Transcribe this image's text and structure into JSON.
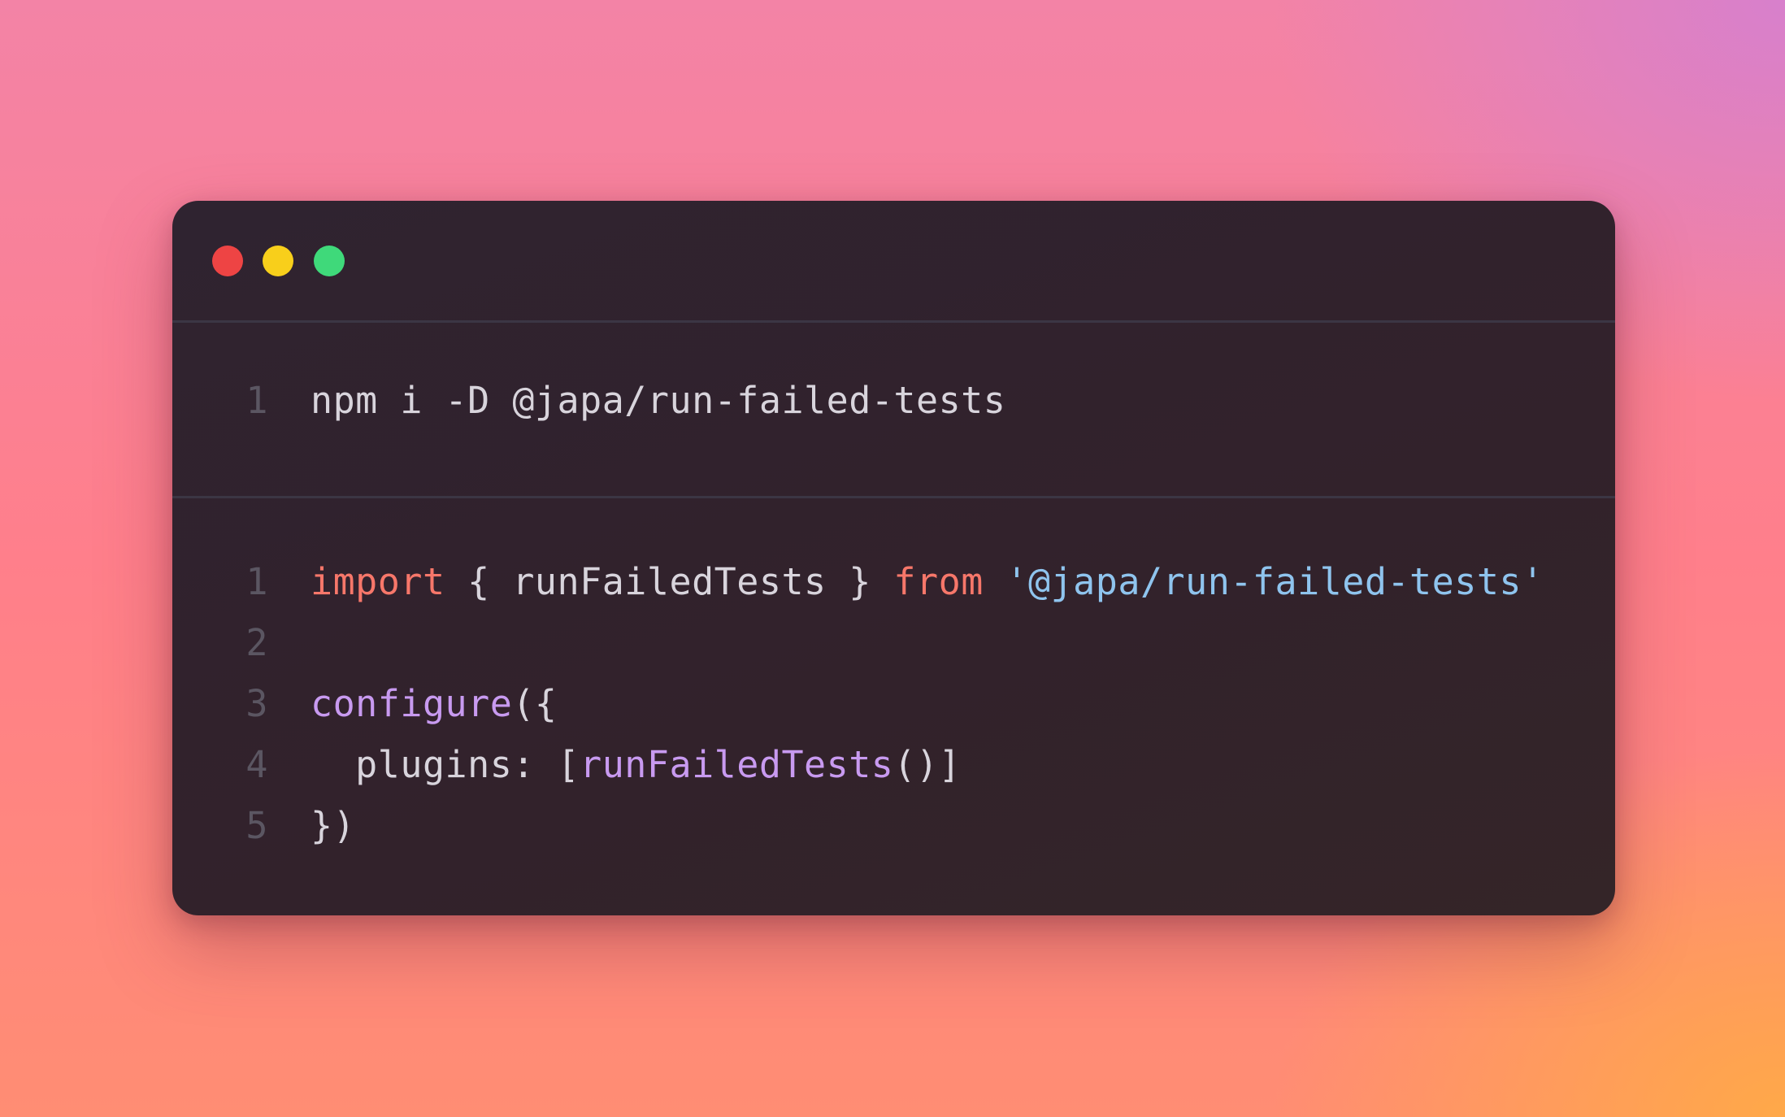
{
  "window_controls": {
    "close_color": "#ee4444",
    "minimize_color": "#f8cf1b",
    "maximize_color": "#3fd97a"
  },
  "terminal_block": {
    "lines": [
      {
        "number": "1",
        "tokens": [
          {
            "text": "npm i -D @japa/run-failed-tests",
            "type": "plain"
          }
        ]
      }
    ]
  },
  "code_block": {
    "lines": [
      {
        "number": "1",
        "tokens": [
          {
            "text": "import",
            "type": "keyword"
          },
          {
            "text": " { runFailedTests } ",
            "type": "plain"
          },
          {
            "text": "from",
            "type": "keyword"
          },
          {
            "text": " ",
            "type": "plain"
          },
          {
            "text": "'@japa/run-failed-tests'",
            "type": "string"
          }
        ]
      },
      {
        "number": "2",
        "tokens": []
      },
      {
        "number": "3",
        "tokens": [
          {
            "text": "configure",
            "type": "func"
          },
          {
            "text": "({",
            "type": "plain"
          }
        ]
      },
      {
        "number": "4",
        "tokens": [
          {
            "text": "  plugins: [",
            "type": "plain"
          },
          {
            "text": "runFailedTests",
            "type": "func"
          },
          {
            "text": "()]",
            "type": "plain"
          }
        ]
      },
      {
        "number": "5",
        "tokens": [
          {
            "text": "})",
            "type": "plain"
          }
        ]
      }
    ]
  }
}
